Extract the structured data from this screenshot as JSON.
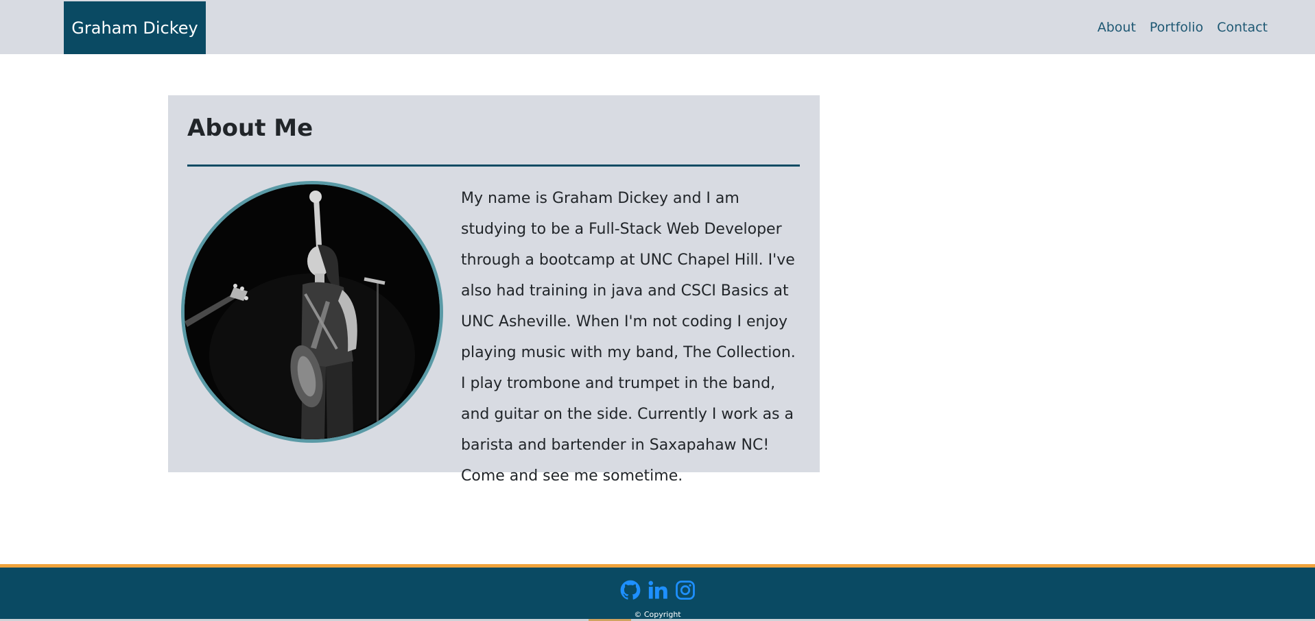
{
  "nav": {
    "brand": "Graham Dickey",
    "links": [
      "About",
      "Portfolio",
      "Contact"
    ]
  },
  "about": {
    "title": "About Me",
    "portrait_icon": "musician-portrait",
    "bio": "My name is Graham Dickey and I am studying to be a Full-Stack Web Developer through a bootcamp at UNC Chapel Hill. I've also had training in java and CSCI Basics at UNC Asheville. When I'm not coding I enjoy playing music with my band, The Collection. I play trombone and trumpet in the band, and guitar on the side. Currently I work as a barista and bartender in Saxapahaw NC! Come and see me sometime."
  },
  "footer": {
    "social_icons": [
      "github-icon",
      "linkedin-icon",
      "instagram-icon"
    ],
    "copyright": "© Copyright"
  },
  "colors": {
    "brand_bg": "#0a4a63",
    "nav_bg": "#d8dbe2",
    "card_bg": "#d8dbe2",
    "footer_bg": "#0a4a63",
    "footer_border": "#f0a33c",
    "social_icon": "#1e90ff",
    "portrait_border": "#5a9aa6"
  }
}
